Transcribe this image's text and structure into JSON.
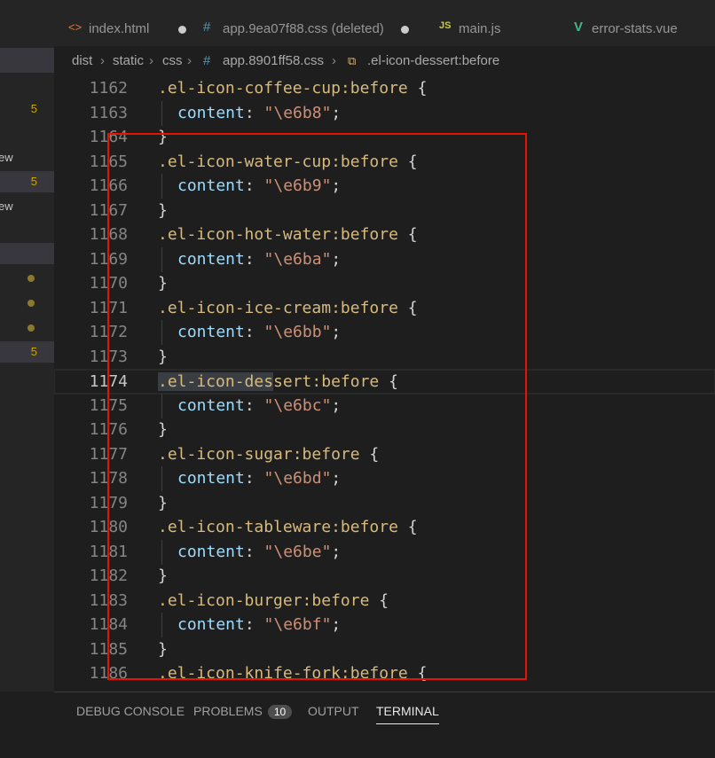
{
  "tabs": [
    {
      "label": "index.html",
      "icon": "<>",
      "modified": true,
      "active": false
    },
    {
      "label": "app.9ea07f88.css (deleted)",
      "icon": "#",
      "modified": true,
      "active": false
    },
    {
      "label": "main.js",
      "icon": "JS",
      "modified": false,
      "active": false
    },
    {
      "label": "error-stats.vue",
      "icon": "V",
      "modified": false,
      "active": false
    }
  ],
  "breadcrumb": [
    "dist",
    "static",
    "css",
    "app.8901ff58.css",
    ".el-icon-dessert:before"
  ],
  "sidebar": {
    "badges": [
      "5",
      "5",
      "5"
    ],
    "texts": [
      "ew",
      "ew"
    ]
  },
  "code": {
    "lines": [
      {
        "n": "1162",
        "t": "sel",
        "s": ".el-icon-coffee-cup:before"
      },
      {
        "n": "1163",
        "t": "prop",
        "v": "\"\\e6b8\""
      },
      {
        "n": "1164",
        "t": "close"
      },
      {
        "n": "1165",
        "t": "sel",
        "s": ".el-icon-water-cup:before"
      },
      {
        "n": "1166",
        "t": "prop",
        "v": "\"\\e6b9\""
      },
      {
        "n": "1167",
        "t": "close"
      },
      {
        "n": "1168",
        "t": "sel",
        "s": ".el-icon-hot-water:before"
      },
      {
        "n": "1169",
        "t": "prop",
        "v": "\"\\e6ba\""
      },
      {
        "n": "1170",
        "t": "close"
      },
      {
        "n": "1171",
        "t": "sel",
        "s": ".el-icon-ice-cream:before"
      },
      {
        "n": "1172",
        "t": "prop",
        "v": "\"\\e6bb\""
      },
      {
        "n": "1173",
        "t": "close"
      },
      {
        "n": "1174",
        "t": "sel",
        "s": ".el-icon-dessert:before"
      },
      {
        "n": "1175",
        "t": "prop",
        "v": "\"\\e6bc\""
      },
      {
        "n": "1176",
        "t": "close"
      },
      {
        "n": "1177",
        "t": "sel",
        "s": ".el-icon-sugar:before"
      },
      {
        "n": "1178",
        "t": "prop",
        "v": "\"\\e6bd\""
      },
      {
        "n": "1179",
        "t": "close"
      },
      {
        "n": "1180",
        "t": "sel",
        "s": ".el-icon-tableware:before"
      },
      {
        "n": "1181",
        "t": "prop",
        "v": "\"\\e6be\""
      },
      {
        "n": "1182",
        "t": "close"
      },
      {
        "n": "1183",
        "t": "sel",
        "s": ".el-icon-burger:before"
      },
      {
        "n": "1184",
        "t": "prop",
        "v": "\"\\e6bf\""
      },
      {
        "n": "1185",
        "t": "close"
      },
      {
        "n": "1186",
        "t": "sel",
        "s": ".el-icon-knife-fork:before"
      }
    ],
    "property": "content",
    "current_line": "1174",
    "highlight": ".el-icon-des"
  },
  "panel": {
    "tabs": [
      "DEBUG CONSOLE",
      "PROBLEMS",
      "OUTPUT",
      "TERMINAL"
    ],
    "problems_count": "10",
    "active": "TERMINAL"
  },
  "colors": {
    "accent_red": "#e51400",
    "badge_yellow": "#cca700"
  }
}
